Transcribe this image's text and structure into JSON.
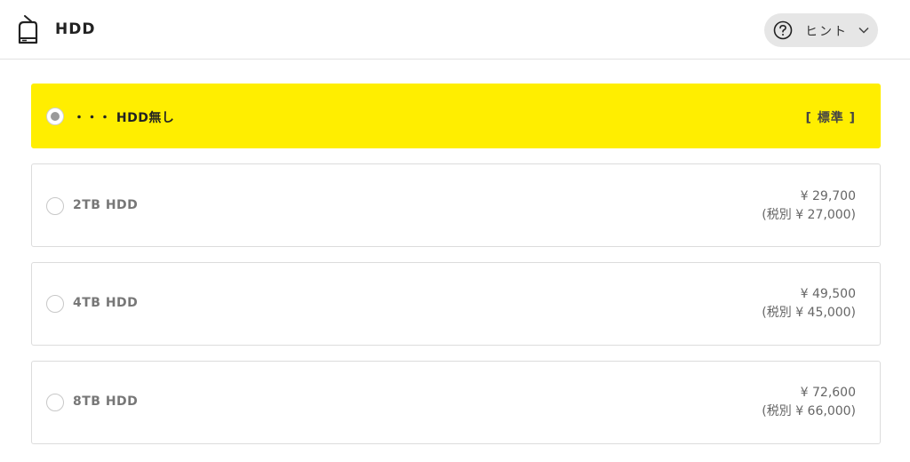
{
  "header": {
    "title": "HDD",
    "icon": "hdd-icon",
    "hint_label": "ヒント",
    "hint_icon": "question-circle-icon",
    "hint_chevron": "chevron-down-icon"
  },
  "options": [
    {
      "label": "・・・ HDD無し",
      "badge": "[ 標準 ]",
      "selected": true
    },
    {
      "label": "2TB HDD",
      "price": "¥ 29,700",
      "price_ex_tax": "(税別 ¥ 27,000)",
      "selected": false
    },
    {
      "label": "4TB HDD",
      "price": "¥ 49,500",
      "price_ex_tax": "(税別 ¥ 45,000)",
      "selected": false
    },
    {
      "label": "8TB HDD",
      "price": "¥ 72,600",
      "price_ex_tax": "(税別 ¥ 66,000)",
      "selected": false
    }
  ],
  "colors": {
    "selected_bg": "#ffee00",
    "border": "#dcdcdc",
    "hint_bg": "#e6e6e6"
  }
}
